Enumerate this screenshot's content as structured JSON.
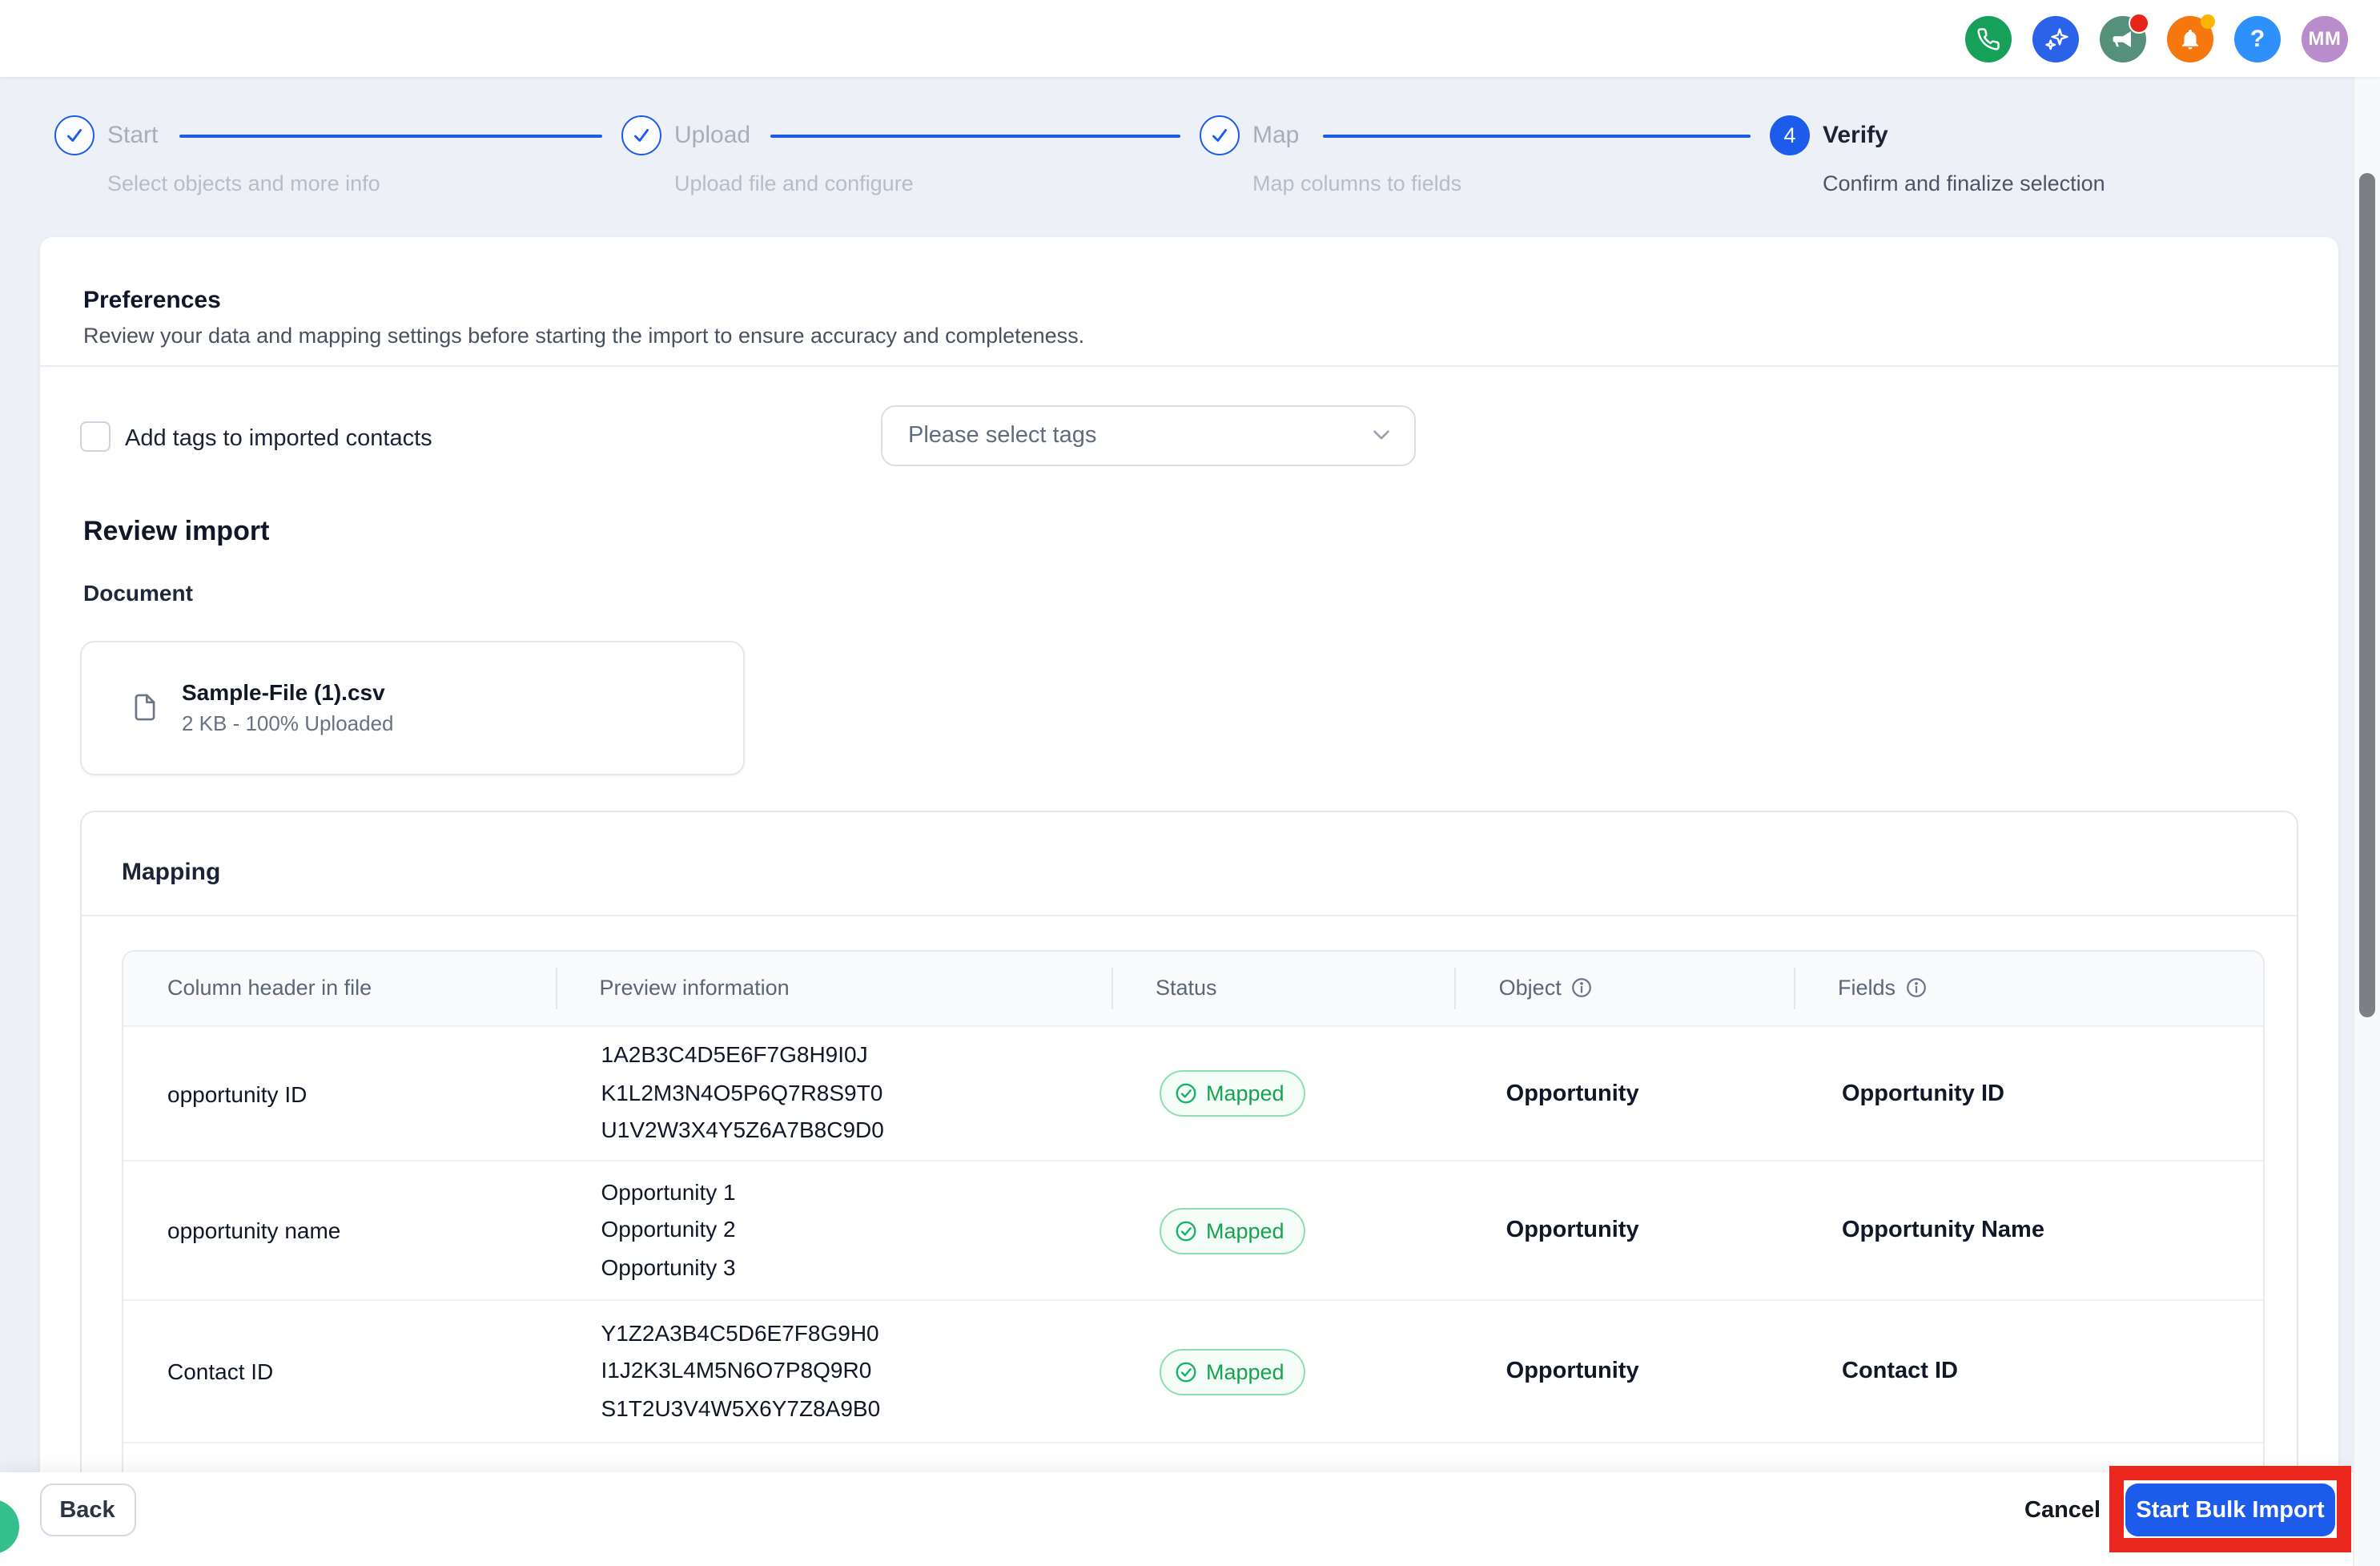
{
  "colors": {
    "accent_blue": "#1d5beb",
    "success_green": "#17a24f",
    "highlight_red": "#ea281e",
    "page_background": "#edf1f7"
  },
  "topbar": {
    "icons": [
      {
        "name": "phone",
        "color": "#16a05a"
      },
      {
        "name": "ai-sparkles",
        "color": "#2a62e9"
      },
      {
        "name": "announcements-megaphone",
        "color": "#55907a",
        "badge_color": "#e82519"
      },
      {
        "name": "notifications-bell",
        "color": "#f7770f",
        "badge_color": "#ffb400"
      },
      {
        "name": "help",
        "color": "#2e90fa",
        "glyph": "?"
      }
    ],
    "avatar": {
      "initials": "MM",
      "color": "#b98ccb"
    }
  },
  "stepper": {
    "steps": [
      {
        "label": "Start",
        "sublabel": "Select objects and more info",
        "state": "done"
      },
      {
        "label": "Upload",
        "sublabel": "Upload file and configure",
        "state": "done"
      },
      {
        "label": "Map",
        "sublabel": "Map columns to fields",
        "state": "done"
      },
      {
        "label": "Verify",
        "sublabel": "Confirm and finalize selection",
        "state": "active",
        "number": "4"
      }
    ]
  },
  "preferences": {
    "title": "Preferences",
    "description": "Review your data and mapping settings before starting the import to ensure accuracy and completeness.",
    "add_tags_label": "Add tags to imported contacts",
    "tags_placeholder": "Please select tags"
  },
  "review": {
    "title": "Review import",
    "document_label": "Document",
    "file": {
      "name": "Sample-File (1).csv",
      "meta": "2 KB - 100% Uploaded"
    }
  },
  "mapping": {
    "title": "Mapping",
    "columns": [
      "Column header in file",
      "Preview information",
      "Status",
      "Object",
      "Fields"
    ],
    "rows": [
      {
        "header": "opportunity ID",
        "preview": [
          "1A2B3C4D5E6F7G8H9I0J",
          "K1L2M3N4O5P6Q7R8S9T0",
          "U1V2W3X4Y5Z6A7B8C9D0"
        ],
        "status": "Mapped",
        "object": "Opportunity",
        "field": "Opportunity ID"
      },
      {
        "header": "opportunity name",
        "preview": [
          "Opportunity 1",
          "Opportunity 2",
          "Opportunity 3"
        ],
        "status": "Mapped",
        "object": "Opportunity",
        "field": "Opportunity Name"
      },
      {
        "header": "Contact ID",
        "preview": [
          "Y1Z2A3B4C5D6E7F8G9H0",
          "I1J2K3L4M5N6O7P8Q9R0",
          "S1T2U3V4W5X6Y7Z8A9B0"
        ],
        "status": "Mapped",
        "object": "Opportunity",
        "field": "Contact ID"
      }
    ]
  },
  "footer": {
    "back": "Back",
    "cancel": "Cancel",
    "submit": "Start Bulk Import"
  }
}
